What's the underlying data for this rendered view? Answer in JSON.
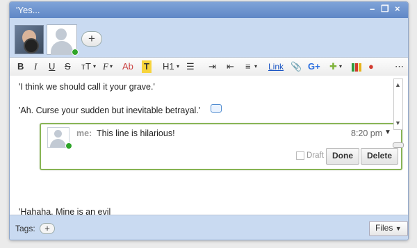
{
  "window": {
    "title": "'Yes...",
    "controls": [
      "–",
      "❐",
      "×"
    ]
  },
  "participants": {
    "add_label": "+"
  },
  "toolbar": {
    "bold": "B",
    "italic": "I",
    "underline": "U",
    "strike": "S",
    "size": "тT",
    "font": "F",
    "color": "Ab",
    "highlight": "T",
    "heading": "H1",
    "link": "Link",
    "more": "⋯"
  },
  "editor": {
    "lines": [
      "'I think we should call it your grave.'",
      "'Ah. Curse your sudden but inevitable betrayal.'",
      "'Hahaha. Mine is an evil"
    ]
  },
  "comment": {
    "author": "me:",
    "text": "This line is hilarious!",
    "time": "8:20 pm",
    "draft_label": "Draft",
    "done_label": "Done",
    "delete_label": "Delete"
  },
  "footer": {
    "tags_label": "Tags:",
    "tag_add": "+",
    "files_label": "Files"
  },
  "colors": {
    "titlebar": "#6b93cf",
    "panel": "#c9daf1",
    "comment_border": "#87b454",
    "online": "#2fa52a"
  }
}
